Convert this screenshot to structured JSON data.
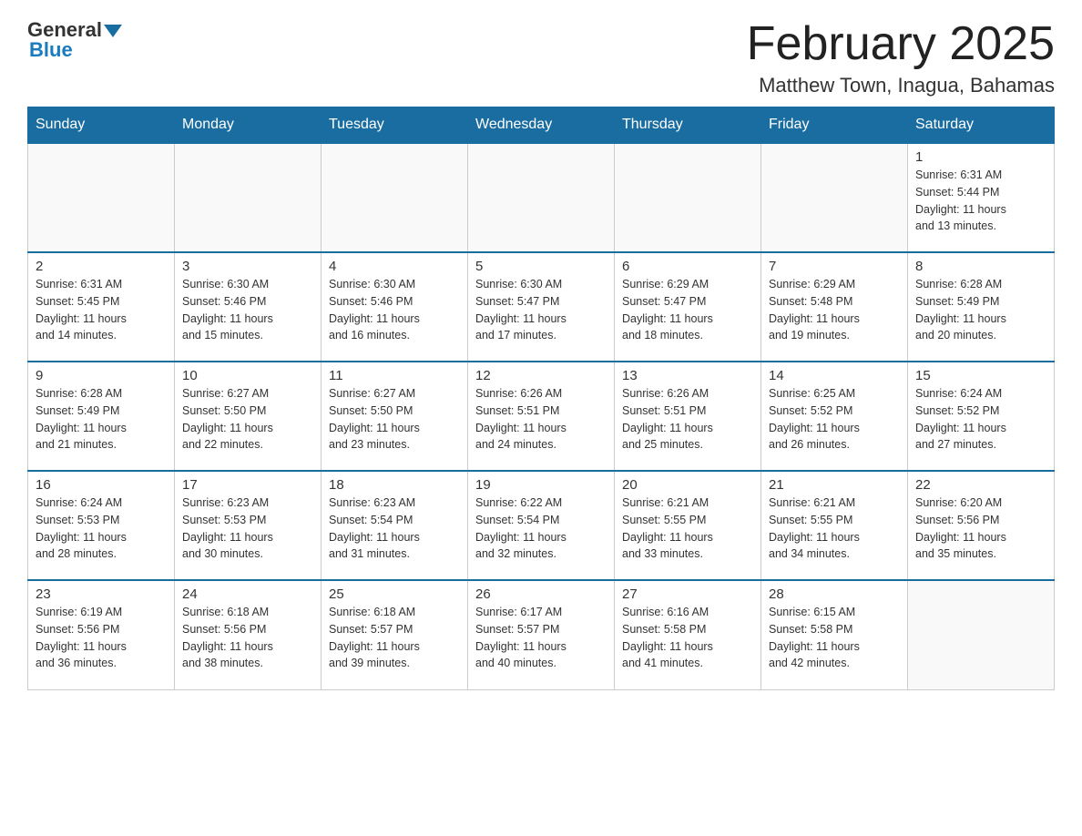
{
  "header": {
    "logo_general": "General",
    "logo_blue": "Blue",
    "month_title": "February 2025",
    "location": "Matthew Town, Inagua, Bahamas"
  },
  "days_of_week": [
    "Sunday",
    "Monday",
    "Tuesday",
    "Wednesday",
    "Thursday",
    "Friday",
    "Saturday"
  ],
  "weeks": [
    [
      {
        "day": "",
        "info": ""
      },
      {
        "day": "",
        "info": ""
      },
      {
        "day": "",
        "info": ""
      },
      {
        "day": "",
        "info": ""
      },
      {
        "day": "",
        "info": ""
      },
      {
        "day": "",
        "info": ""
      },
      {
        "day": "1",
        "info": "Sunrise: 6:31 AM\nSunset: 5:44 PM\nDaylight: 11 hours\nand 13 minutes."
      }
    ],
    [
      {
        "day": "2",
        "info": "Sunrise: 6:31 AM\nSunset: 5:45 PM\nDaylight: 11 hours\nand 14 minutes."
      },
      {
        "day": "3",
        "info": "Sunrise: 6:30 AM\nSunset: 5:46 PM\nDaylight: 11 hours\nand 15 minutes."
      },
      {
        "day": "4",
        "info": "Sunrise: 6:30 AM\nSunset: 5:46 PM\nDaylight: 11 hours\nand 16 minutes."
      },
      {
        "day": "5",
        "info": "Sunrise: 6:30 AM\nSunset: 5:47 PM\nDaylight: 11 hours\nand 17 minutes."
      },
      {
        "day": "6",
        "info": "Sunrise: 6:29 AM\nSunset: 5:47 PM\nDaylight: 11 hours\nand 18 minutes."
      },
      {
        "day": "7",
        "info": "Sunrise: 6:29 AM\nSunset: 5:48 PM\nDaylight: 11 hours\nand 19 minutes."
      },
      {
        "day": "8",
        "info": "Sunrise: 6:28 AM\nSunset: 5:49 PM\nDaylight: 11 hours\nand 20 minutes."
      }
    ],
    [
      {
        "day": "9",
        "info": "Sunrise: 6:28 AM\nSunset: 5:49 PM\nDaylight: 11 hours\nand 21 minutes."
      },
      {
        "day": "10",
        "info": "Sunrise: 6:27 AM\nSunset: 5:50 PM\nDaylight: 11 hours\nand 22 minutes."
      },
      {
        "day": "11",
        "info": "Sunrise: 6:27 AM\nSunset: 5:50 PM\nDaylight: 11 hours\nand 23 minutes."
      },
      {
        "day": "12",
        "info": "Sunrise: 6:26 AM\nSunset: 5:51 PM\nDaylight: 11 hours\nand 24 minutes."
      },
      {
        "day": "13",
        "info": "Sunrise: 6:26 AM\nSunset: 5:51 PM\nDaylight: 11 hours\nand 25 minutes."
      },
      {
        "day": "14",
        "info": "Sunrise: 6:25 AM\nSunset: 5:52 PM\nDaylight: 11 hours\nand 26 minutes."
      },
      {
        "day": "15",
        "info": "Sunrise: 6:24 AM\nSunset: 5:52 PM\nDaylight: 11 hours\nand 27 minutes."
      }
    ],
    [
      {
        "day": "16",
        "info": "Sunrise: 6:24 AM\nSunset: 5:53 PM\nDaylight: 11 hours\nand 28 minutes."
      },
      {
        "day": "17",
        "info": "Sunrise: 6:23 AM\nSunset: 5:53 PM\nDaylight: 11 hours\nand 30 minutes."
      },
      {
        "day": "18",
        "info": "Sunrise: 6:23 AM\nSunset: 5:54 PM\nDaylight: 11 hours\nand 31 minutes."
      },
      {
        "day": "19",
        "info": "Sunrise: 6:22 AM\nSunset: 5:54 PM\nDaylight: 11 hours\nand 32 minutes."
      },
      {
        "day": "20",
        "info": "Sunrise: 6:21 AM\nSunset: 5:55 PM\nDaylight: 11 hours\nand 33 minutes."
      },
      {
        "day": "21",
        "info": "Sunrise: 6:21 AM\nSunset: 5:55 PM\nDaylight: 11 hours\nand 34 minutes."
      },
      {
        "day": "22",
        "info": "Sunrise: 6:20 AM\nSunset: 5:56 PM\nDaylight: 11 hours\nand 35 minutes."
      }
    ],
    [
      {
        "day": "23",
        "info": "Sunrise: 6:19 AM\nSunset: 5:56 PM\nDaylight: 11 hours\nand 36 minutes."
      },
      {
        "day": "24",
        "info": "Sunrise: 6:18 AM\nSunset: 5:56 PM\nDaylight: 11 hours\nand 38 minutes."
      },
      {
        "day": "25",
        "info": "Sunrise: 6:18 AM\nSunset: 5:57 PM\nDaylight: 11 hours\nand 39 minutes."
      },
      {
        "day": "26",
        "info": "Sunrise: 6:17 AM\nSunset: 5:57 PM\nDaylight: 11 hours\nand 40 minutes."
      },
      {
        "day": "27",
        "info": "Sunrise: 6:16 AM\nSunset: 5:58 PM\nDaylight: 11 hours\nand 41 minutes."
      },
      {
        "day": "28",
        "info": "Sunrise: 6:15 AM\nSunset: 5:58 PM\nDaylight: 11 hours\nand 42 minutes."
      },
      {
        "day": "",
        "info": ""
      }
    ]
  ]
}
